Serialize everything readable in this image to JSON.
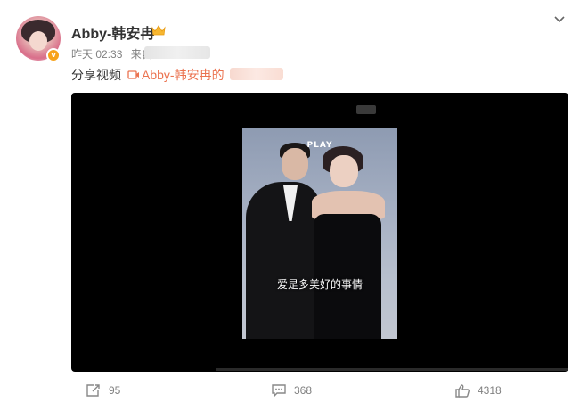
{
  "post": {
    "username": "Abby-韩安冉",
    "time": "昨天 02:33",
    "source_prefix": "来自",
    "text": "分享视频",
    "video_link_label": "Abby-韩安冉的"
  },
  "video": {
    "play_label": "PLAY",
    "subtitle": "爱是多美好的事情"
  },
  "actions": {
    "repost_count": "95",
    "comment_count": "368",
    "like_count": "4318"
  },
  "colors": {
    "link": "#eb7350",
    "badge": "#f7a21b",
    "muted": "#808080"
  },
  "icons": [
    "avatar",
    "verified-badge-icon",
    "crown-icon",
    "chevron-down-icon",
    "video-link-icon",
    "repost-icon",
    "comment-icon",
    "like-icon"
  ]
}
